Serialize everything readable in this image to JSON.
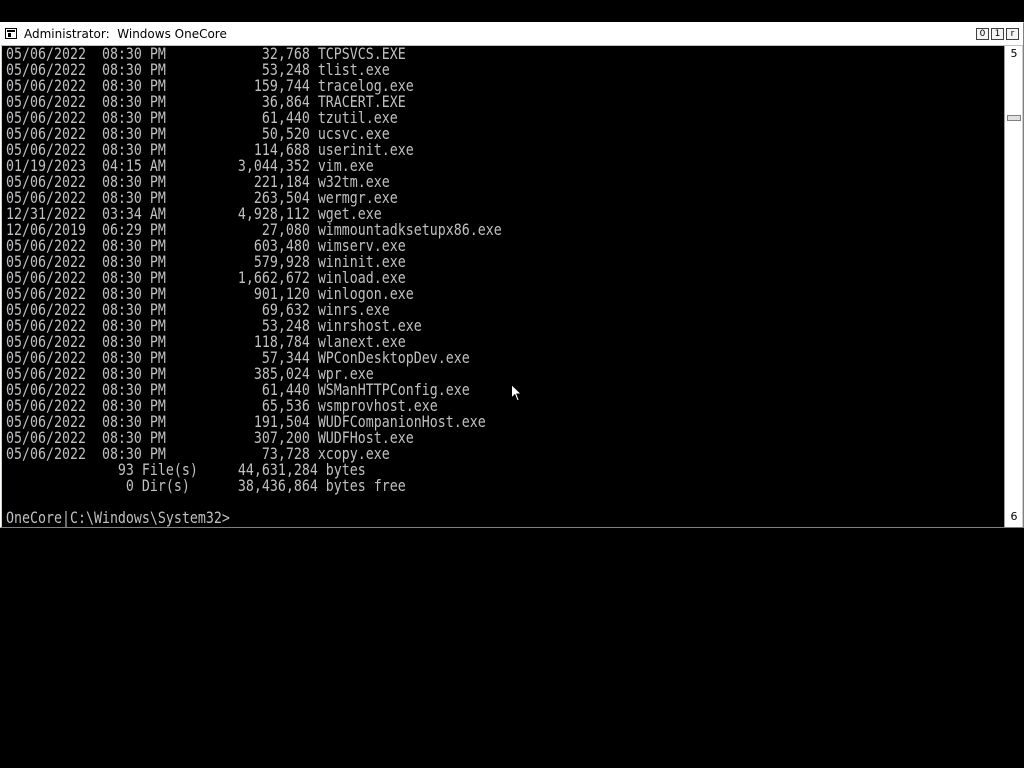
{
  "window": {
    "title": "Administrator:  Windows OneCore",
    "buttons": {
      "minimize": "0",
      "maximize": "1",
      "close": "r"
    }
  },
  "console": {
    "listing": [
      {
        "date": "05/06/2022",
        "time": "08:30 PM",
        "size": "32,768",
        "name": "TCPSVCS.EXE"
      },
      {
        "date": "05/06/2022",
        "time": "08:30 PM",
        "size": "53,248",
        "name": "tlist.exe"
      },
      {
        "date": "05/06/2022",
        "time": "08:30 PM",
        "size": "159,744",
        "name": "tracelog.exe"
      },
      {
        "date": "05/06/2022",
        "time": "08:30 PM",
        "size": "36,864",
        "name": "TRACERT.EXE"
      },
      {
        "date": "05/06/2022",
        "time": "08:30 PM",
        "size": "61,440",
        "name": "tzutil.exe"
      },
      {
        "date": "05/06/2022",
        "time": "08:30 PM",
        "size": "50,520",
        "name": "ucsvc.exe"
      },
      {
        "date": "05/06/2022",
        "time": "08:30 PM",
        "size": "114,688",
        "name": "userinit.exe"
      },
      {
        "date": "01/19/2023",
        "time": "04:15 AM",
        "size": "3,044,352",
        "name": "vim.exe"
      },
      {
        "date": "05/06/2022",
        "time": "08:30 PM",
        "size": "221,184",
        "name": "w32tm.exe"
      },
      {
        "date": "05/06/2022",
        "time": "08:30 PM",
        "size": "263,504",
        "name": "wermgr.exe"
      },
      {
        "date": "12/31/2022",
        "time": "03:34 AM",
        "size": "4,928,112",
        "name": "wget.exe"
      },
      {
        "date": "12/06/2019",
        "time": "06:29 PM",
        "size": "27,080",
        "name": "wimmountadksetupx86.exe"
      },
      {
        "date": "05/06/2022",
        "time": "08:30 PM",
        "size": "603,480",
        "name": "wimserv.exe"
      },
      {
        "date": "05/06/2022",
        "time": "08:30 PM",
        "size": "579,928",
        "name": "wininit.exe"
      },
      {
        "date": "05/06/2022",
        "time": "08:30 PM",
        "size": "1,662,672",
        "name": "winload.exe"
      },
      {
        "date": "05/06/2022",
        "time": "08:30 PM",
        "size": "901,120",
        "name": "winlogon.exe"
      },
      {
        "date": "05/06/2022",
        "time": "08:30 PM",
        "size": "69,632",
        "name": "winrs.exe"
      },
      {
        "date": "05/06/2022",
        "time": "08:30 PM",
        "size": "53,248",
        "name": "winrshost.exe"
      },
      {
        "date": "05/06/2022",
        "time": "08:30 PM",
        "size": "118,784",
        "name": "wlanext.exe"
      },
      {
        "date": "05/06/2022",
        "time": "08:30 PM",
        "size": "57,344",
        "name": "WPConDesktopDev.exe"
      },
      {
        "date": "05/06/2022",
        "time": "08:30 PM",
        "size": "385,024",
        "name": "wpr.exe"
      },
      {
        "date": "05/06/2022",
        "time": "08:30 PM",
        "size": "61,440",
        "name": "WSManHTTPConfig.exe"
      },
      {
        "date": "05/06/2022",
        "time": "08:30 PM",
        "size": "65,536",
        "name": "wsmprovhost.exe"
      },
      {
        "date": "05/06/2022",
        "time": "08:30 PM",
        "size": "191,504",
        "name": "WUDFCompanionHost.exe"
      },
      {
        "date": "05/06/2022",
        "time": "08:30 PM",
        "size": "307,200",
        "name": "WUDFHost.exe"
      },
      {
        "date": "05/06/2022",
        "time": "08:30 PM",
        "size": "73,728",
        "name": "xcopy.exe"
      }
    ],
    "summary_files": "              93 File(s)     44,631,284 bytes",
    "summary_dirs": "               0 Dir(s)      38,436,864 bytes free",
    "prompt": "OneCore|C:\\Windows\\System32>"
  },
  "scrollbar": {
    "top_label": "5",
    "bottom_label": "6"
  },
  "colors": {
    "console_bg": "#000000",
    "console_fg": "#c0c0c0",
    "titlebar_bg": "#ffffff"
  }
}
